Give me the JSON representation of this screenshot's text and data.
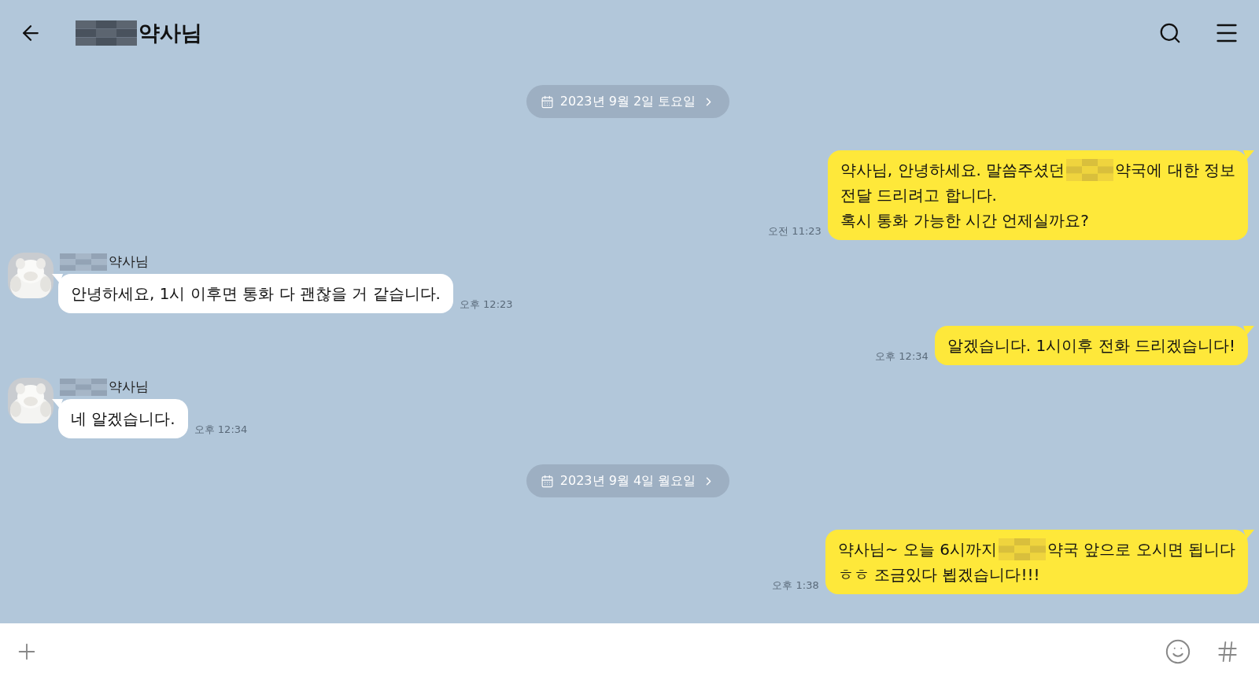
{
  "header": {
    "title": [
      {
        "kind": "redacted"
      },
      {
        "kind": "text",
        "text": "약사님"
      }
    ]
  },
  "messages": [
    {
      "kind": "date",
      "text": "2023년 9월 2일 토요일"
    },
    {
      "kind": "sent",
      "time": "오전 11:23",
      "lines": [
        [
          {
            "kind": "text",
            "text": "약사님, 안녕하세요. 말씀주셨던"
          },
          {
            "kind": "redacted"
          },
          {
            "kind": "text",
            "text": "약국에 대한 정보"
          }
        ],
        [
          {
            "kind": "text",
            "text": "전달 드리려고 합니다."
          }
        ],
        [
          {
            "kind": "text",
            "text": "혹시 통화 가능한 시간 언제실까요?"
          }
        ]
      ]
    },
    {
      "kind": "received",
      "sender": [
        {
          "kind": "redacted"
        },
        {
          "kind": "text",
          "text": "약사님"
        }
      ],
      "time": "오후 12:23",
      "lines": [
        [
          {
            "kind": "text",
            "text": "안녕하세요, 1시 이후면 통화 다 괜찮을 거 같습니다."
          }
        ]
      ]
    },
    {
      "kind": "sent",
      "time": "오후 12:34",
      "lines": [
        [
          {
            "kind": "text",
            "text": "알겠습니다. 1시이후 전화 드리겠습니다!"
          }
        ]
      ]
    },
    {
      "kind": "received",
      "sender": [
        {
          "kind": "redacted"
        },
        {
          "kind": "text",
          "text": "약사님"
        }
      ],
      "time": "오후 12:34",
      "lines": [
        [
          {
            "kind": "text",
            "text": "네 알겠습니다."
          }
        ]
      ]
    },
    {
      "kind": "date",
      "text": "2023년 9월 4일 월요일"
    },
    {
      "kind": "sent",
      "time": "오후 1:38",
      "lines": [
        [
          {
            "kind": "text",
            "text": "약사님~ 오늘 6시까지"
          },
          {
            "kind": "redacted"
          },
          {
            "kind": "text",
            "text": "약국 앞으로 오시면 됩니다"
          }
        ],
        [
          {
            "kind": "text",
            "text": "ㅎㅎ 조금있다 뵙겠습니다!!!"
          }
        ]
      ]
    }
  ]
}
